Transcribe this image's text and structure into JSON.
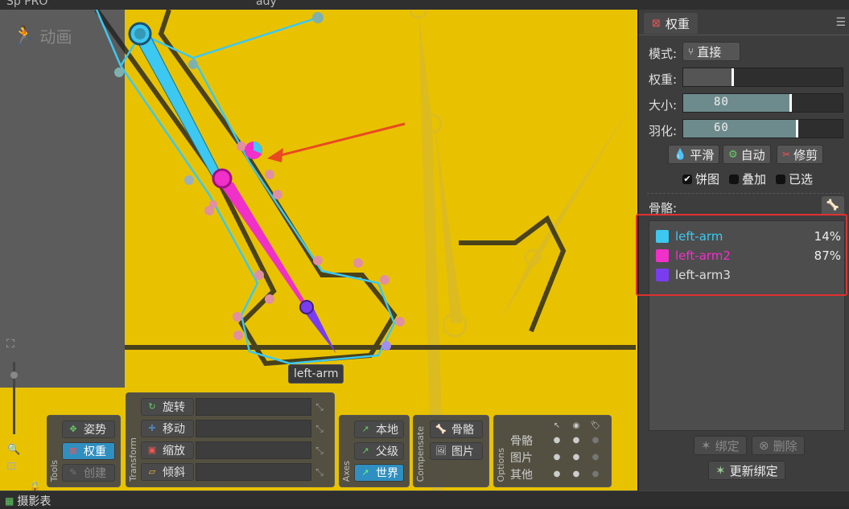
{
  "app": {
    "partial_title": "Sp    PRO",
    "partial_file": "ady"
  },
  "viewport": {
    "mode_label": "动画",
    "bone_tooltip": "left-arm"
  },
  "toolbar": {
    "tools": {
      "title": "Tools",
      "pose": "姿势",
      "weights": "权重",
      "create": "创建"
    },
    "transform": {
      "title": "Transform",
      "rotate": "旋转",
      "translate": "移动",
      "scale": "缩放",
      "shear": "倾斜"
    },
    "axes": {
      "title": "Axes",
      "local": "本地",
      "parent": "父级",
      "world": "世界"
    },
    "compensate": {
      "title": "Compensate",
      "bones": "骨骼",
      "images": "图片"
    },
    "options": {
      "title": "Options",
      "rows": [
        "骨骼",
        "图片",
        "其他"
      ]
    }
  },
  "weights_panel": {
    "tab_label": "权重",
    "mode_label": "模式:",
    "mode_value": "直接",
    "weight_label": "权重:",
    "weight_level": 0.32,
    "size_label": "大小:",
    "size_value": "80",
    "size_level": 0.68,
    "feather_label": "羽化:",
    "feather_value": "60",
    "feather_level": 0.72,
    "smooth_button": "平滑",
    "auto_button": "自动",
    "prune_button": "修剪",
    "pie_label": "饼图",
    "pie_checked": true,
    "overlay_label": "叠加",
    "overlay_checked": false,
    "selected_label": "已选",
    "selected_checked": false,
    "bones_label": "骨骼:",
    "bones": [
      {
        "name": "left-arm",
        "color": "#3cc8f0",
        "weight": "14%"
      },
      {
        "name": "left-arm2",
        "color": "#f030c8",
        "weight": "87%"
      },
      {
        "name": "left-arm3",
        "color": "#7a3cf0",
        "weight": ""
      }
    ],
    "bind_button": "绑定",
    "delete_button": "删除",
    "update_bind_button": "更新绑定"
  },
  "bottom": {
    "dopesheet_label": "摄影表"
  },
  "colors": {
    "background": "#e8c200",
    "accent": "#2f8fc0",
    "highlight": "#e03030"
  }
}
